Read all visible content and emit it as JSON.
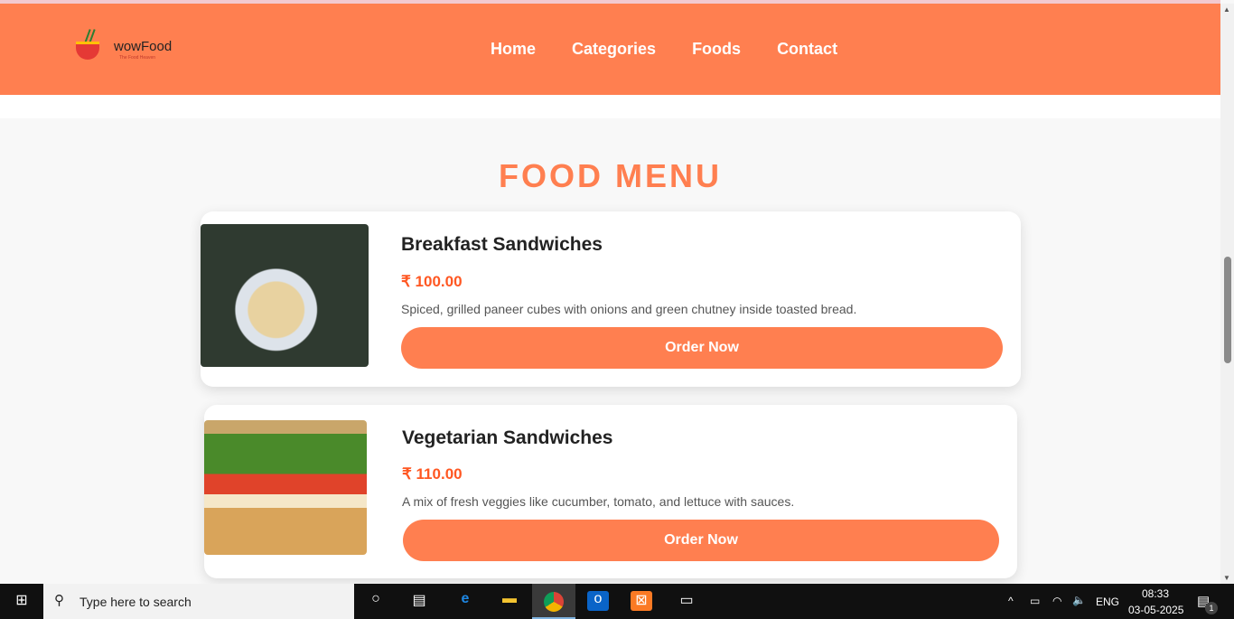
{
  "header": {
    "logo_name": "wowFood",
    "logo_tagline": "The Food Heaven",
    "nav": [
      "Home",
      "Categories",
      "Foods",
      "Contact"
    ]
  },
  "main": {
    "title": "FOOD MENU",
    "items": [
      {
        "name": "Breakfast Sandwiches",
        "price": "₹ 100.00",
        "description": "Spiced, grilled paneer cubes with onions and green chutney inside toasted bread.",
        "button": "Order Now"
      },
      {
        "name": "Vegetarian Sandwiches",
        "price": "₹ 110.00",
        "description": "A mix of fresh veggies like cucumber, tomato, and lettuce with sauces.",
        "button": "Order Now"
      }
    ]
  },
  "taskbar": {
    "search_placeholder": "Type here to search",
    "language": "ENG",
    "time": "08:33",
    "date": "03-05-2025",
    "notifications": "1"
  },
  "colors": {
    "accent": "#ff7f50",
    "price": "#ff5722"
  }
}
